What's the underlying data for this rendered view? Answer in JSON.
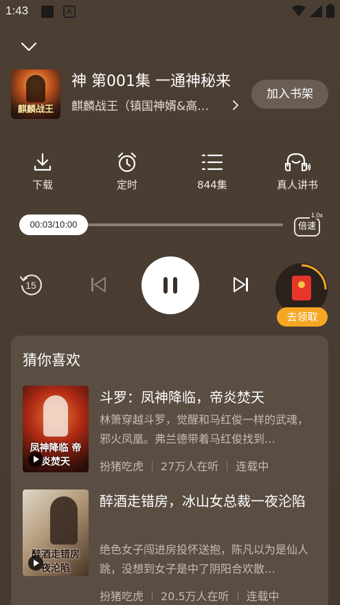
{
  "status_bar": {
    "time": "1:43"
  },
  "now_playing": {
    "cover_text": "麒麟战王",
    "title": "神 第001集 一通神秘来",
    "book_name": "麒麟战王（镇国神婿&高…",
    "add_shelf_label": "加入书架"
  },
  "actions": [
    {
      "icon": "download-icon",
      "label": "下载"
    },
    {
      "icon": "alarm-clock-icon",
      "label": "定时"
    },
    {
      "icon": "list-icon",
      "label": "844集"
    },
    {
      "icon": "headphones-voice-icon",
      "label": "真人讲书"
    }
  ],
  "player": {
    "time_display": "00:03/10:00",
    "progress_fraction": 0.005,
    "speed_label": "倍速",
    "speed_value": "1.0x",
    "rewind_seconds": "15",
    "state": "playing"
  },
  "red_packet": {
    "claim_label": "去领取"
  },
  "recommend": {
    "title": "猜你喜欢",
    "books": [
      {
        "title": "斗罗：凤神降临，帝炎焚天",
        "desc": "林箫穿越斗罗，觉醒和马红俊一样的武魂，邪火凤凰。弗兰德带着马红俊找到…",
        "author": "扮猪吃虎",
        "listeners": "27万人在听",
        "status": "连载中",
        "cover_text": "凤神降临 帝炎焚天",
        "cover_colors": [
          "#e9572a",
          "#7b1f12",
          "#1c0b07"
        ]
      },
      {
        "title": "醉酒走错房，冰山女总裁一夜沦陷",
        "desc": "绝色女子闯进房投怀送抱，陈凡以为是仙人跳，没想到女子是中了阴阳合欢散…",
        "author": "扮猪吃虎",
        "listeners": "20.5万人在听",
        "status": "连载中",
        "cover_text": "醉酒走错房 夜沦陷",
        "cover_colors": [
          "#d8d0c2",
          "#8a6a4c",
          "#2a1d15"
        ]
      }
    ]
  }
}
